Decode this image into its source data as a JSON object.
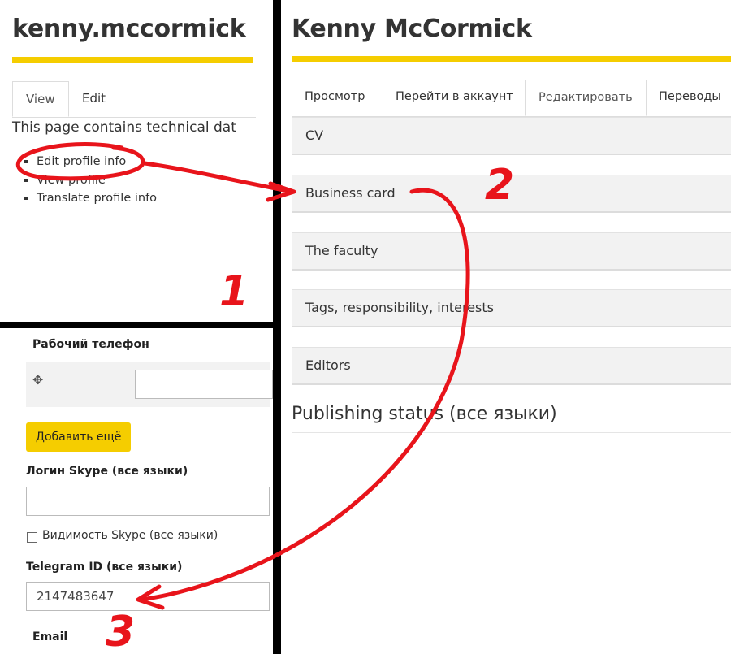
{
  "profile_panel": {
    "username": "kenny.mccormick",
    "tabs": [
      {
        "label": "View"
      },
      {
        "label": "Edit"
      }
    ],
    "tech_text": "This page contains technical dat",
    "links": [
      {
        "label": "Edit profile info"
      },
      {
        "label": "View profile"
      },
      {
        "label": "Translate profile info"
      }
    ]
  },
  "edit_panel": {
    "title": "Kenny McCormick",
    "tabs": [
      {
        "label": "Просмотр"
      },
      {
        "label": "Перейти в аккаунт"
      },
      {
        "label": "Редактировать"
      },
      {
        "label": "Переводы"
      }
    ],
    "sections": [
      {
        "label": "CV"
      },
      {
        "label": "Business card"
      },
      {
        "label": "The faculty"
      },
      {
        "label": "Tags, responsibility, interests"
      },
      {
        "label": "Editors"
      }
    ],
    "publishing_status": "Publishing status (все языки)"
  },
  "form_panel": {
    "work_phone_label": "Рабочий телефон",
    "work_phone_value": "",
    "add_more_label": "Добавить ещё",
    "skype_label": "Логин Skype (все языки)",
    "skype_value": "",
    "skype_visibility_label": "Видимость Skype (все языки)",
    "skype_visibility_checked": false,
    "telegram_label": "Telegram ID (все языки)",
    "telegram_value": "2147483647",
    "email_label": "Email"
  },
  "annotations": {
    "step_numbers": [
      "1",
      "2",
      "3"
    ],
    "color": "#e8141b"
  },
  "colors": {
    "accent_yellow": "#f5cd00",
    "accordion_bg": "#f2f2f2"
  }
}
